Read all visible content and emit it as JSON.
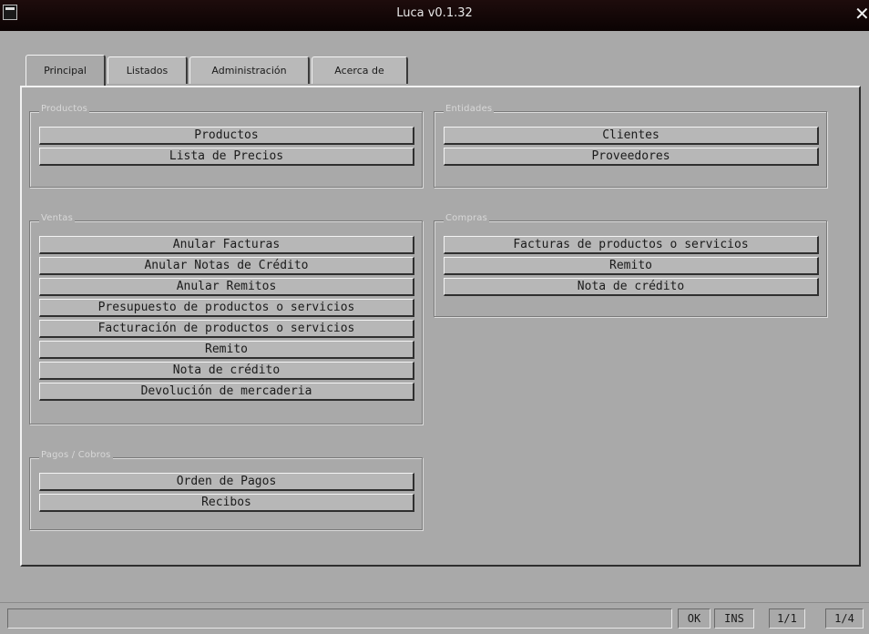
{
  "window": {
    "title": "Luca v0.1.32"
  },
  "tabs": [
    {
      "label": "Principal"
    },
    {
      "label": "Listados"
    },
    {
      "label": "Administración"
    },
    {
      "label": "Acerca de"
    }
  ],
  "groups": {
    "productos": {
      "label": "Productos",
      "buttons": [
        "Productos",
        "Lista de Precios"
      ]
    },
    "entidades": {
      "label": "Entidades",
      "buttons": [
        "Clientes",
        "Proveedores"
      ]
    },
    "ventas": {
      "label": "Ventas",
      "buttons": [
        "Anular Facturas",
        "Anular Notas de Crédito",
        "Anular Remitos",
        "Presupuesto de productos o servicios",
        "Facturación de productos o servicios",
        "Remito",
        "Nota de crédito",
        "Devolución de mercaderia"
      ]
    },
    "compras": {
      "label": "Compras",
      "buttons": [
        "Facturas de productos o servicios",
        "Remito",
        "Nota de crédito"
      ]
    },
    "pagos": {
      "label": "Pagos / Cobros",
      "buttons": [
        "Orden de Pagos",
        "Recibos"
      ]
    }
  },
  "statusbar": {
    "ok": "OK",
    "ins": "INS",
    "page": "1/1",
    "index": "1/4"
  },
  "icons": {
    "system_menu": "window-menu-icon",
    "close": "close-icon"
  }
}
